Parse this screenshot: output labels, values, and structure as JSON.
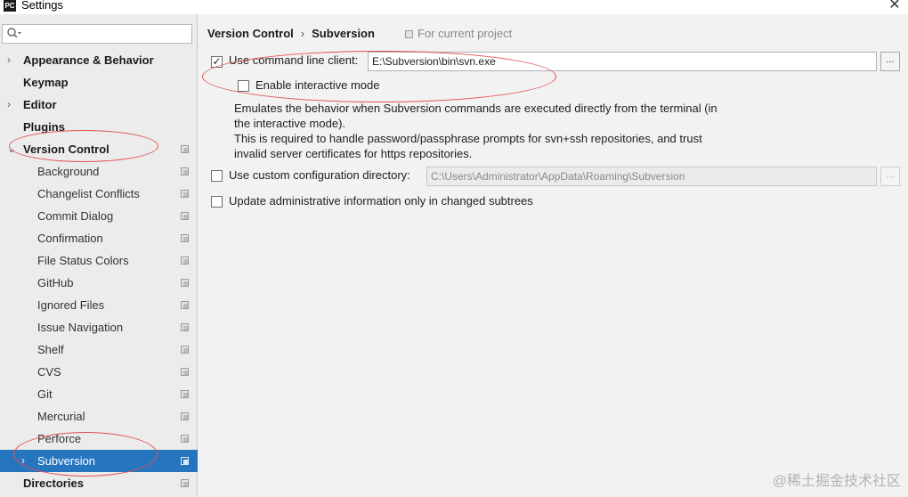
{
  "window": {
    "title": "Settings",
    "app_icon": "PC",
    "close_glyph": "✕"
  },
  "sidebar": {
    "search": {
      "value": "",
      "placeholder": ""
    },
    "items": [
      {
        "label": "Appearance & Behavior",
        "level": "top",
        "has_arrow": true,
        "arrow": "›"
      },
      {
        "label": "Keymap",
        "level": "top"
      },
      {
        "label": "Editor",
        "level": "top",
        "has_arrow": true,
        "arrow": "›"
      },
      {
        "label": "Plugins",
        "level": "top"
      },
      {
        "label": "Version Control",
        "level": "top",
        "has_arrow": true,
        "arrow": "⌄",
        "project_icon": true
      },
      {
        "label": "Background",
        "level": "child",
        "project_icon": true
      },
      {
        "label": "Changelist Conflicts",
        "level": "child",
        "project_icon": true
      },
      {
        "label": "Commit Dialog",
        "level": "child",
        "project_icon": true
      },
      {
        "label": "Confirmation",
        "level": "child",
        "project_icon": true
      },
      {
        "label": "File Status Colors",
        "level": "child",
        "project_icon": true
      },
      {
        "label": "GitHub",
        "level": "child",
        "project_icon": true
      },
      {
        "label": "Ignored Files",
        "level": "child",
        "project_icon": true
      },
      {
        "label": "Issue Navigation",
        "level": "child",
        "project_icon": true
      },
      {
        "label": "Shelf",
        "level": "child",
        "project_icon": true
      },
      {
        "label": "CVS",
        "level": "child",
        "project_icon": true
      },
      {
        "label": "Git",
        "level": "child",
        "project_icon": true
      },
      {
        "label": "Mercurial",
        "level": "child",
        "project_icon": true
      },
      {
        "label": "Perforce",
        "level": "child",
        "project_icon": true
      },
      {
        "label": "Subversion",
        "level": "child",
        "has_arrow": true,
        "arrow": "›",
        "project_icon": true,
        "selected": true
      },
      {
        "label": "Directories",
        "level": "top",
        "project_icon": true
      }
    ]
  },
  "main": {
    "breadcrumb": {
      "parent": "Version Control",
      "separator": "›",
      "current": "Subversion",
      "scope": "For current project"
    },
    "command_line": {
      "checked": true,
      "label": "Use command line client:",
      "value": "E:\\Subversion\\bin\\svn.exe",
      "browse_label": "..."
    },
    "interactive_mode": {
      "checked": false,
      "label": "Enable interactive mode"
    },
    "description": [
      "Emulates the behavior when Subversion commands are executed directly from the terminal (in",
      "the interactive mode).",
      "This is required to handle password/passphrase prompts for svn+ssh repositories, and trust",
      "invalid server certificates for https repositories."
    ],
    "custom_config": {
      "checked": false,
      "label": "Use custom configuration directory:",
      "value": "C:\\Users\\Administrator\\AppData\\Roaming\\Subversion",
      "browse_label": "..."
    },
    "update_admin": {
      "checked": false,
      "label": "Update administrative information only in changed subtrees"
    }
  },
  "watermark": "@稀土掘金技术社区",
  "colors": {
    "selection": "#2675bf",
    "annotation": "#e05050"
  }
}
